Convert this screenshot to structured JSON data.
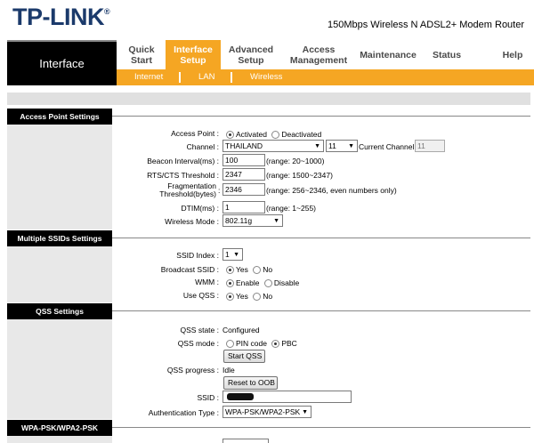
{
  "header": {
    "logo": "TP-LINK",
    "logo_mark": "®",
    "model": "150Mbps Wireless N ADSL2+ Modem Router"
  },
  "nav": {
    "section_title": "Interface",
    "items": [
      {
        "line1": "Quick",
        "line2": "Start"
      },
      {
        "line1": "Interface",
        "line2": "Setup"
      },
      {
        "line1": "Advanced",
        "line2": "Setup"
      },
      {
        "line1": "Access",
        "line2": "Management"
      },
      {
        "line1": "Maintenance",
        "line2": ""
      },
      {
        "line1": "Status",
        "line2": ""
      },
      {
        "line1": "Help",
        "line2": ""
      }
    ],
    "subitems": [
      "Internet",
      "LAN",
      "Wireless"
    ]
  },
  "ap": {
    "heading": "Access Point Settings",
    "access_point_label": "Access Point :",
    "activated": "Activated",
    "deactivated": "Deactivated",
    "channel_label": "Channel :",
    "channel_country": "THAILAND",
    "channel_number": "11",
    "current_channel_label": "Current Channel:",
    "current_channel": "11",
    "beacon_label": "Beacon Interval(ms) :",
    "beacon_value": "100",
    "beacon_range": "(range: 20~1000)",
    "rts_label": "RTS/CTS Threshold :",
    "rts_value": "2347",
    "rts_range": "(range: 1500~2347)",
    "frag_label1": "Fragmentation",
    "frag_label2": "Threshold(bytes)",
    "frag_colon": ":",
    "frag_value": "2346",
    "frag_range": "(range: 256~2346, even numbers only)",
    "dtim_label": "DTIM(ms) :",
    "dtim_value": "1",
    "dtim_range": "(range: 1~255)",
    "mode_label": "Wireless Mode :",
    "mode_value": "802.11g"
  },
  "ssid": {
    "heading": "Multiple SSIDs Settings",
    "index_label": "SSID Index :",
    "index_value": "1",
    "broadcast_label": "Broadcast SSID :",
    "wmm_label": "WMM :",
    "qss_label": "Use QSS :",
    "yes": "Yes",
    "no": "No",
    "enable": "Enable",
    "disable": "Disable"
  },
  "qss": {
    "heading": "QSS Settings",
    "state_label": "QSS state :",
    "state_value": "Configured",
    "mode_label": "QSS mode :",
    "pin_code": "PIN code",
    "pbc": "PBC",
    "start_button": "Start QSS",
    "progress_label": "QSS progress :",
    "progress_value": "Idle",
    "reset_button": "Reset to OOB",
    "ssid_label": "SSID :",
    "auth_label": "Authentication Type :",
    "auth_value": "WPA-PSK/WPA2-PSK"
  },
  "wpa": {
    "heading": "WPA-PSK/WPA2-PSK"
  }
}
